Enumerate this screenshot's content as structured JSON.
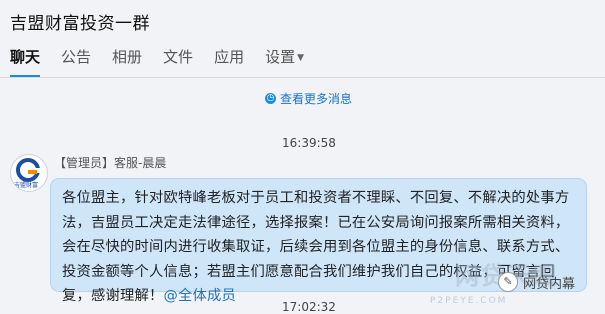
{
  "window": {
    "title": "吉盟财富投资一群"
  },
  "tabs": [
    {
      "label": "聊天",
      "active": true
    },
    {
      "label": "公告"
    },
    {
      "label": "相册"
    },
    {
      "label": "文件"
    },
    {
      "label": "应用"
    },
    {
      "label": "设置"
    }
  ],
  "history": {
    "view_more_label": "查看更多消息"
  },
  "messages": [
    {
      "time": "16:39:58",
      "sender_role": "【管理员】",
      "sender_name": "客服-晨晨",
      "avatar_text": "吉盟财富",
      "text": "各位盟主，针对欧特峰老板对于员工和投资者不理睬、不回复、不解决的处事方法，吉盟员工决定走法律途径，选择报案！已在公安局询问报案所需相关资料，会在尽快的时间内进行收集取证，后续会用到各位盟主的身份信息、联系方式、投资金额等个人信息；若盟主们愿意配合我们维护我们自己的权益，可留言回复，感谢理解！",
      "mention": "@全体成员"
    },
    {
      "time": "17:02:32"
    }
  ],
  "watermark": {
    "text": "网贷天眼",
    "url": "P2PEYE.COM",
    "brand": "网贷内幕"
  },
  "colors": {
    "accent": "#1a8de0",
    "bubble": "#cfe6f9",
    "background": "#f1f3f6"
  }
}
